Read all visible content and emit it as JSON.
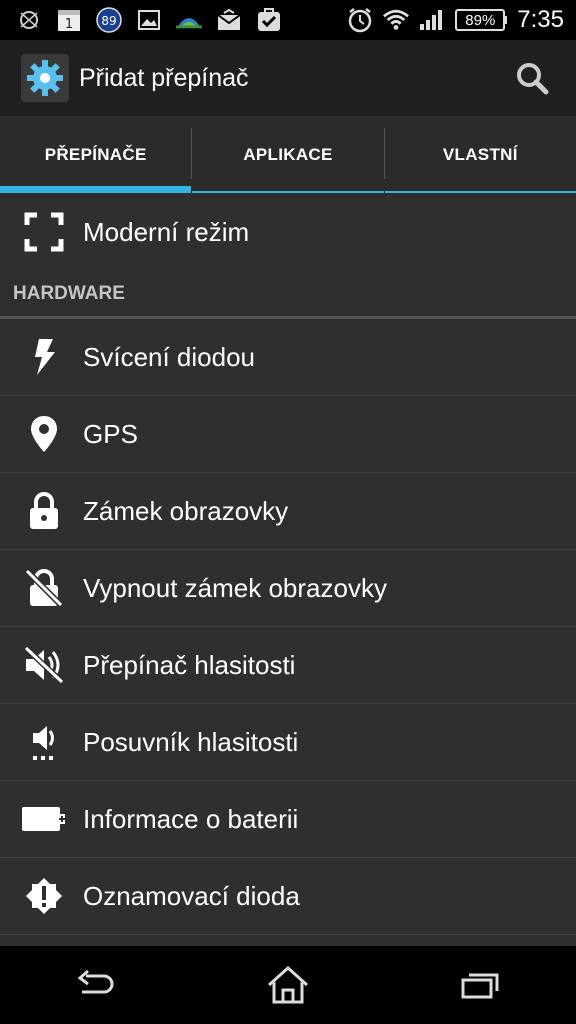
{
  "status_bar": {
    "calendar_day": "1",
    "badge_count": "89",
    "battery_percent": "89%",
    "time": "7:35",
    "icons": [
      "sync-icon",
      "calendar-icon",
      "notification-badge-icon",
      "image-icon",
      "weather-icon",
      "mail-icon",
      "task-icon",
      "alarm-icon",
      "wifi-icon",
      "signal-icon",
      "battery-icon"
    ]
  },
  "action_bar": {
    "title": "Přidat přepínač",
    "icons": [
      "settings-gear-icon",
      "search-icon"
    ]
  },
  "tabs": [
    {
      "label": "PŘEPÍNAČE",
      "active": true
    },
    {
      "label": "APLIKACE",
      "active": false
    },
    {
      "label": "VLASTNÍ",
      "active": false
    }
  ],
  "list": {
    "top_item": {
      "label": "Moderní režim",
      "icon": "fullscreen-icon"
    },
    "section_header": "HARDWARE",
    "items": [
      {
        "label": "Svícení diodou",
        "icon": "flash-icon"
      },
      {
        "label": "GPS",
        "icon": "location-pin-icon"
      },
      {
        "label": "Zámek obrazovky",
        "icon": "lock-icon"
      },
      {
        "label": "Vypnout zámek obrazovky",
        "icon": "lock-off-icon"
      },
      {
        "label": "Přepínač hlasitosti",
        "icon": "volume-mute-icon"
      },
      {
        "label": "Posuvník hlasitosti",
        "icon": "volume-slider-icon"
      },
      {
        "label": "Informace o baterii",
        "icon": "battery-info-icon"
      },
      {
        "label": "Oznamovací dioda",
        "icon": "notification-led-icon"
      }
    ]
  },
  "nav_bar": {
    "icons": [
      "back-icon",
      "home-icon",
      "recent-apps-icon"
    ]
  },
  "colors": {
    "accent": "#33b5e5",
    "background": "#2f2f2f",
    "action_bar": "#202020"
  }
}
